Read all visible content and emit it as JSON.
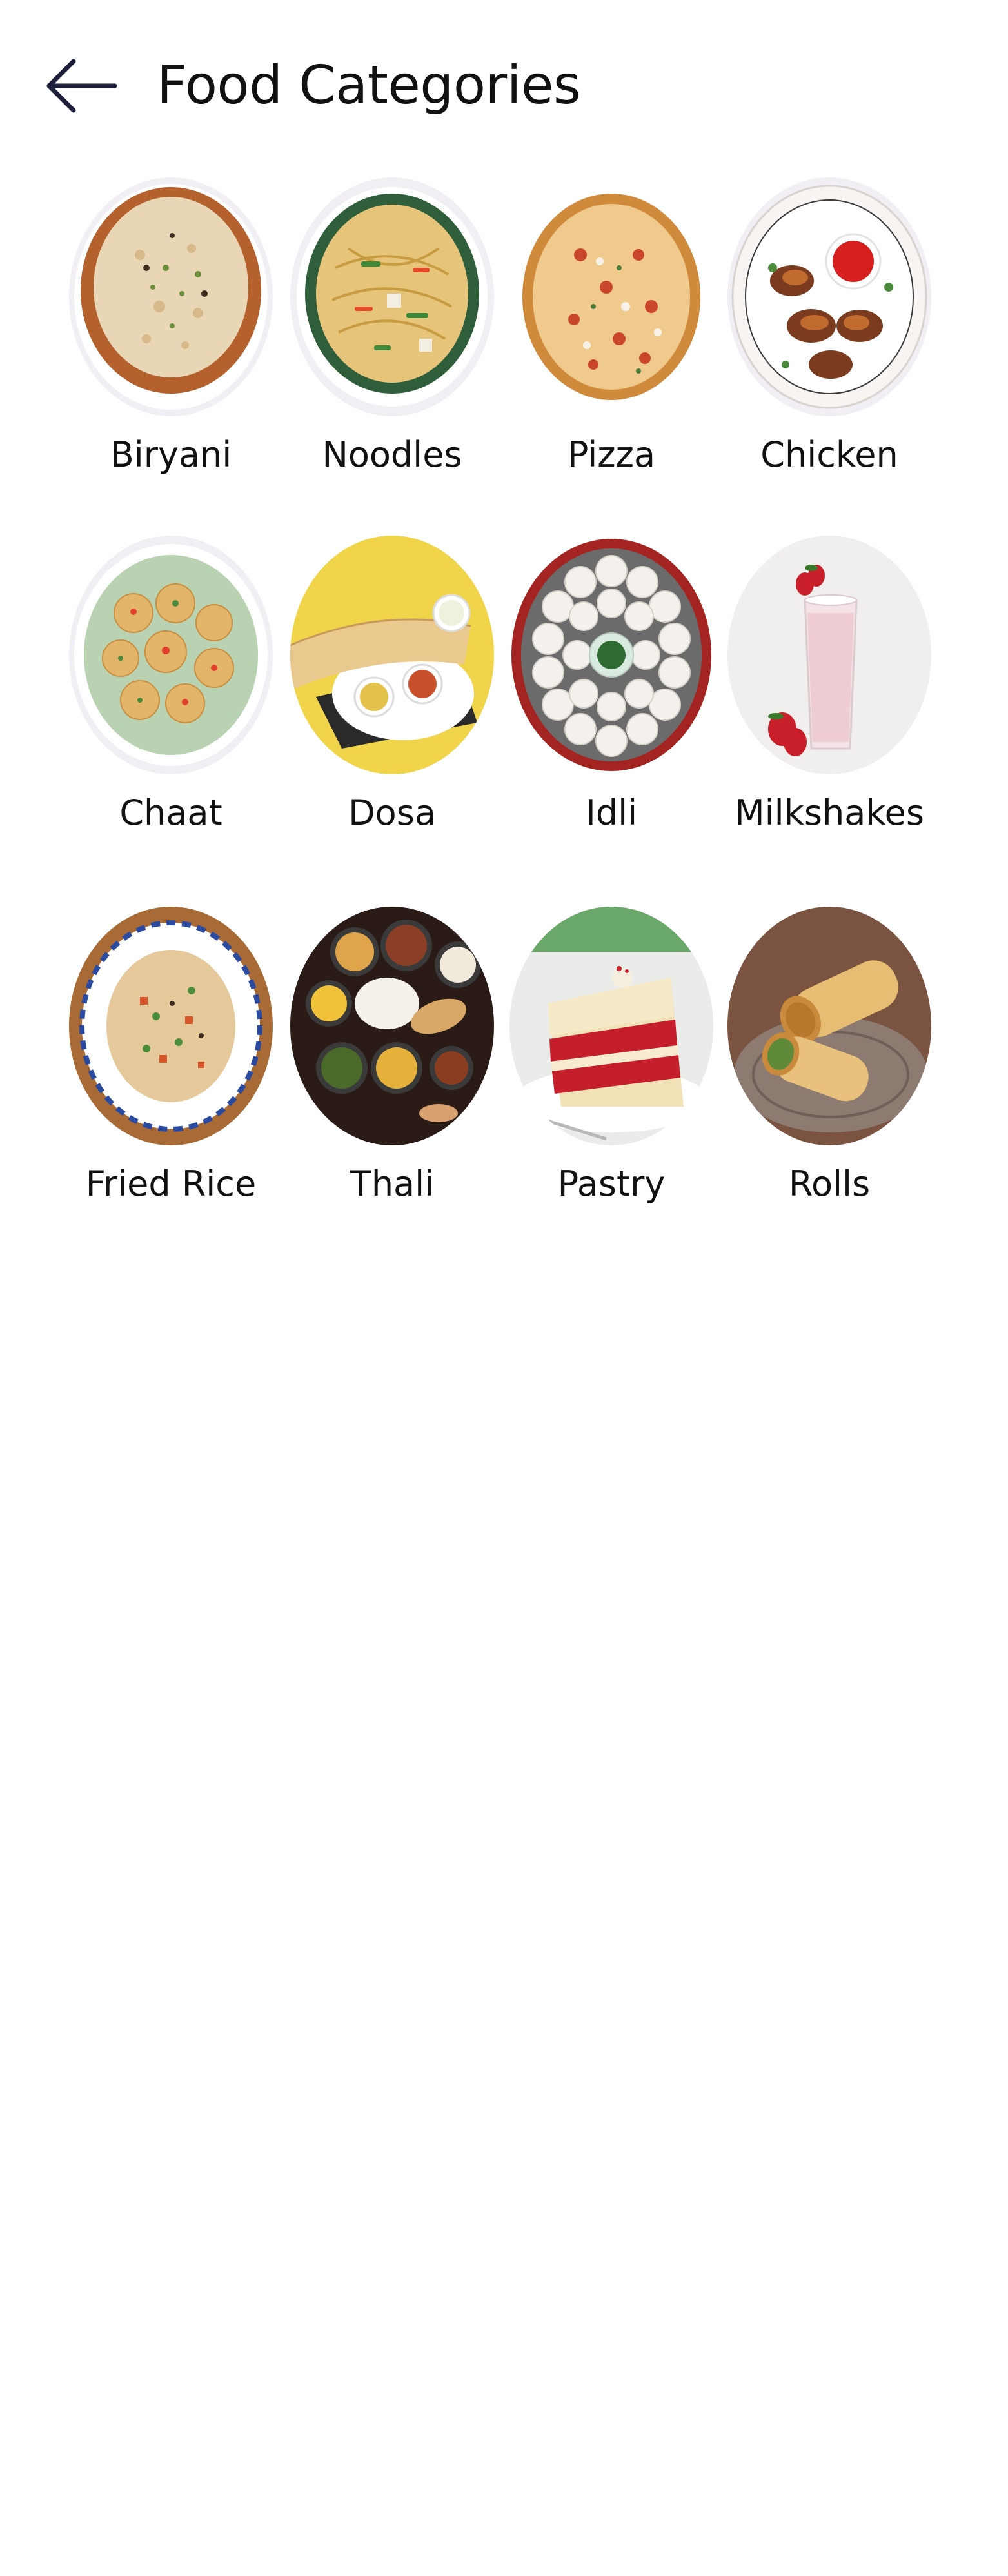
{
  "header": {
    "title": "Food Categories",
    "back_icon": "arrow-left-icon"
  },
  "categories": [
    {
      "label": "Biryani",
      "icon": "biryani-image"
    },
    {
      "label": "Noodles",
      "icon": "noodles-image"
    },
    {
      "label": "Pizza",
      "icon": "pizza-image"
    },
    {
      "label": "Chicken",
      "icon": "chicken-image"
    },
    {
      "label": "Chaat",
      "icon": "chaat-image"
    },
    {
      "label": "Dosa",
      "icon": "dosa-image"
    },
    {
      "label": "Idli",
      "icon": "idli-image"
    },
    {
      "label": "Milkshakes",
      "icon": "milkshake-image"
    },
    {
      "label": "Fried Rice",
      "icon": "fried-rice-image"
    },
    {
      "label": "Thali",
      "icon": "thali-image"
    },
    {
      "label": "Pastry",
      "icon": "pastry-image"
    },
    {
      "label": "Rolls",
      "icon": "rolls-image"
    }
  ],
  "colors": {
    "background": "#ffffff",
    "text": "#111111",
    "back_arrow": "#1c1f3a"
  }
}
